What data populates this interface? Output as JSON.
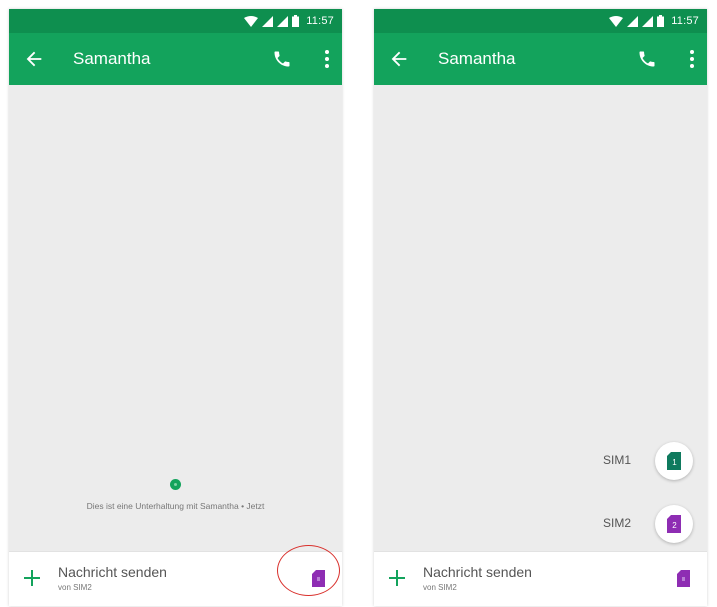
{
  "status_bar": {
    "time": "11:57"
  },
  "app_bar": {
    "contact_name": "Samantha"
  },
  "conversation": {
    "info_text": "Dies ist eine Unterhaltung mit Samantha • Jetzt"
  },
  "compose": {
    "placeholder": "Nachricht senden",
    "sim_hint": "von SIM2"
  },
  "sim_chooser": [
    {
      "label": "SIM1",
      "number": "1",
      "color": "#0f7a5e"
    },
    {
      "label": "SIM2",
      "number": "2",
      "color": "#8e2db3"
    }
  ],
  "colors": {
    "app_bar": "#13a35c",
    "status_bar": "#0e8f4f",
    "highlight_ring": "#d9302c",
    "sim2": "#8e2db3"
  }
}
